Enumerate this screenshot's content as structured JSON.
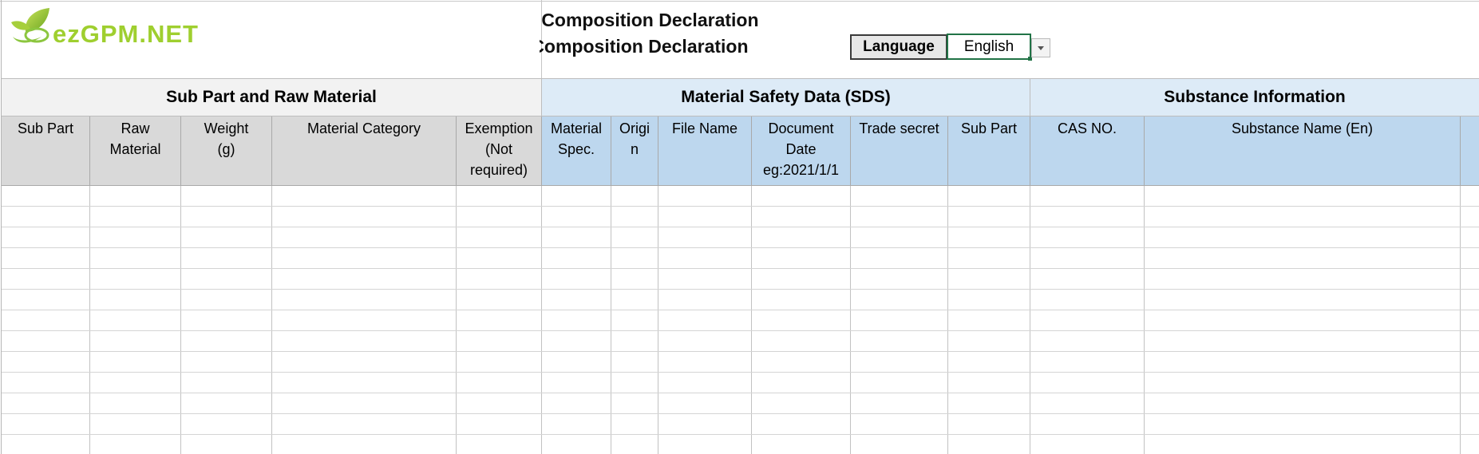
{
  "header": {
    "logo_text": "ezGPM.NET",
    "title_line1": "Material Composition Declaration",
    "title_line2": "Material Composition Declaration",
    "language_label": "Language",
    "language_value": "English"
  },
  "sections": [
    {
      "label": "Sub Part and Raw Material"
    },
    {
      "label": "Material Safety Data (SDS)"
    },
    {
      "label": "Substance Information"
    }
  ],
  "columns": [
    {
      "label": "Sub Part"
    },
    {
      "label": "Raw\nMaterial"
    },
    {
      "label": "Weight\n(g)"
    },
    {
      "label": "Material Category"
    },
    {
      "label": "Exemption\n(Not\nrequired)"
    },
    {
      "label": "Material\nSpec."
    },
    {
      "label": "Origi\nn"
    },
    {
      "label": "File Name"
    },
    {
      "label": "Document\nDate\neg:2021/1/1"
    },
    {
      "label": "Trade secret"
    },
    {
      "label": "Sub Part"
    },
    {
      "label": "CAS NO."
    },
    {
      "label": "Substance Name (En)"
    },
    {
      "label": ""
    }
  ],
  "colors": {
    "section_grey": "#f2f2f2",
    "section_blue": "#ddebf7",
    "header_grey": "#d9d9d9",
    "header_blue": "#bdd7ee",
    "logo_green": "#8cc63f",
    "selection_green": "#217346"
  },
  "icons": {
    "logo": "leaf-logo-icon",
    "dropdown": "chevron-down-icon"
  }
}
